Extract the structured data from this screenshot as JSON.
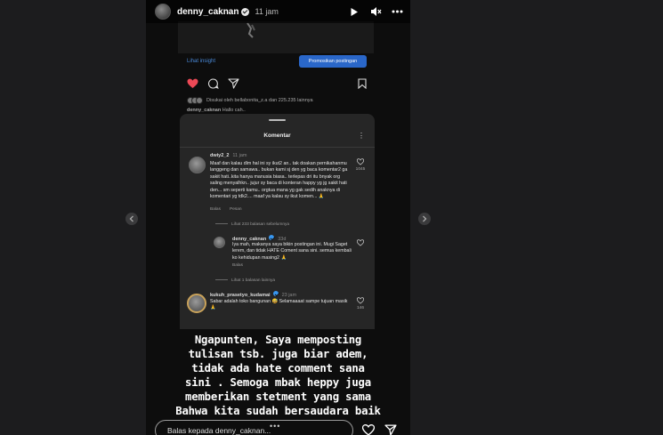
{
  "header": {
    "username": "denny_caknan",
    "time": "11 jam"
  },
  "embedded": {
    "insight_link": "Lihat insight",
    "promote_button": "Promosikan postingan",
    "liked_by": "Disukai oleh bellabonita_z.a dan 225.235 lainnya",
    "caption_user": "denny_caknan",
    "caption_text": "Hallo cah..",
    "sheet_title": "Komentar",
    "comments": [
      {
        "user": "dwiy2_2",
        "time": "11 jam",
        "text": "Maaf dan kalau dlm hal ini sy ikut2 an.. tak doakan pernikahanmu langgeng dan samawa.. bukan kami sj den yg baca komentar2 ga sakit hati..kita hanya manusia biasa.. terlepas dri itu bnyak org saling menyalhkn.. jujur sy baca di konteran happy yg jg sakit hati den... sm seperti kamu.. orgtua mana yg gak sedih anaknya di komentari yg tdk2.... maaf ya kalau sy ikut komen... 🙏",
        "reply": "Balas",
        "message": "Pesan",
        "likes": "1045"
      },
      {
        "view_replies": "Lihat 233 balasan sebelumnya",
        "user": "denny_caknan",
        "time": "33d",
        "text": "Iya mah, makanya saya bikin postingan ini. Mugi Saget lerem, dan tidak HATE Coment sana sini. semua kembali ko kehidupan masing2 🙏",
        "reply": "Balas"
      },
      {
        "view_replies": "Lihat 1 balasan lainnya",
        "user": "kukuh_prasetyo_kudamai",
        "time": "23 jam",
        "text": "Sabar adalah toko bangunan 😅 Selamaaaat sampe tujuan masik🙏",
        "likes": "146"
      }
    ]
  },
  "overlay_lines": [
    "Ngapunten, Saya memposting",
    "tulisan tsb. juga biar adem,",
    "tidak ada hate comment sana",
    "sini . Semoga mbak heppy juga",
    "memberikan stetment yang sama",
    "Bahwa kita sudah bersaudara baik"
  ],
  "reply_placeholder": "Balas kepada denny_caknan...",
  "colors": {
    "accent": "#2a67c9",
    "heart": "#ed4956"
  }
}
